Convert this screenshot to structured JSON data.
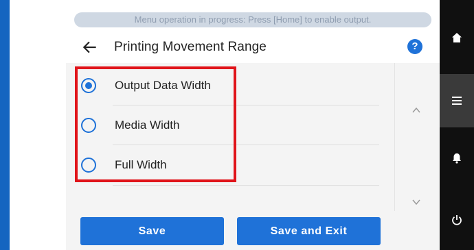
{
  "status_bar": {
    "message": "Menu operation in progress: Press [Home] to enable output."
  },
  "header": {
    "title": "Printing Movement Range",
    "back_icon": "arrow-left-icon",
    "help_icon": "question-circle-icon",
    "help_glyph": "?"
  },
  "options": [
    {
      "label": "Output Data Width",
      "selected": true
    },
    {
      "label": "Media Width",
      "selected": false
    },
    {
      "label": "Full Width",
      "selected": false
    }
  ],
  "scroll": {
    "up_icon": "chevron-up-icon",
    "down_icon": "chevron-down-icon"
  },
  "buttons": {
    "save": "Save",
    "save_and_exit": "Save and Exit"
  },
  "side_nav": [
    {
      "icon": "home-icon"
    },
    {
      "icon": "hamburger-menu-icon",
      "active": true
    },
    {
      "icon": "bell-icon"
    },
    {
      "icon": "power-icon"
    }
  ],
  "colors": {
    "accent": "#1f72d8",
    "highlight": "#e0141a",
    "side_nav_bg": "#101010",
    "left_bar": "#1565c0"
  }
}
